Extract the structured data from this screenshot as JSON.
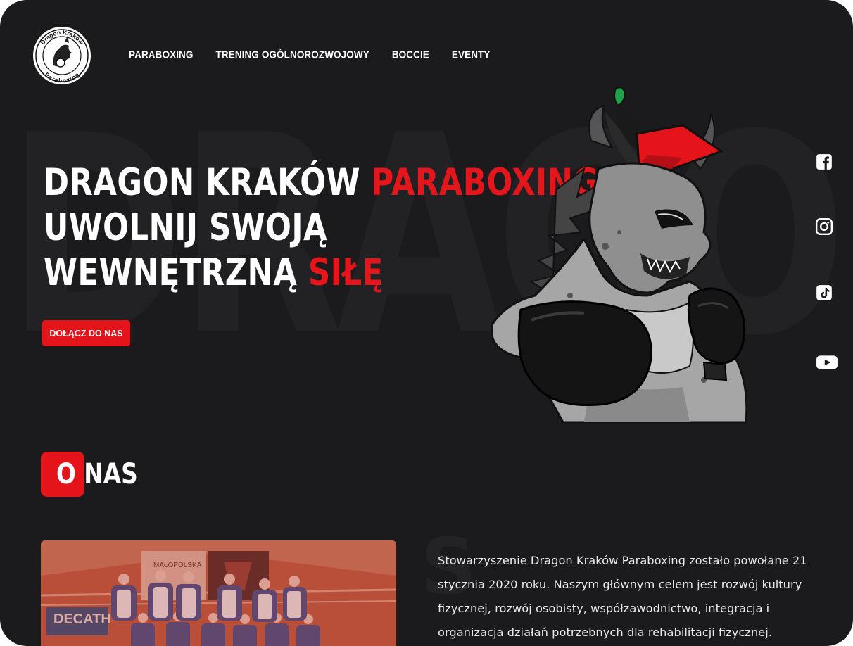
{
  "brand": {
    "logo_alt": "Dragon Kraków Paraboxing logo",
    "logo_top_text": "Dragon Kraków",
    "logo_bottom_text": "Paraboxing",
    "background_word": "DRAGON",
    "colors": {
      "background": "#1b1b1d",
      "accent": "#e4141a",
      "text": "#ffffff"
    }
  },
  "nav": {
    "items": [
      {
        "label": "PARABOXING"
      },
      {
        "label": "TRENING OGÓLNOROZWOJOWY"
      },
      {
        "label": "BOCCIE"
      },
      {
        "label": "EVENTY"
      }
    ]
  },
  "hero": {
    "line1_white": "DRAGON KRAKÓW ",
    "line1_red": "PARABOXING",
    "line2": "UWOLNIJ SWOJĄ",
    "line3_white": "WEWNĘTRZNĄ ",
    "line3_red": "SIŁĘ",
    "cta_label": "DOŁĄCZ DO NAS",
    "mascot": "boxing-dragon-illustration"
  },
  "social": [
    {
      "icon": "facebook-icon"
    },
    {
      "icon": "instagram-icon"
    },
    {
      "icon": "tiktok-icon"
    },
    {
      "icon": "youtube-icon"
    }
  ],
  "about": {
    "title_first": "O",
    "title_rest": " NAS",
    "ghost_letter": "S",
    "photo": "team-group-photo",
    "banner_text": "MAŁOPOLSKA",
    "sign_text": "DECATH",
    "paragraph": "Stowarzyszenie Dragon Kraków Paraboxing zostało powołane 21 stycznia 2020 roku. Naszym głównym celem jest rozwój kultury fizycznej, rozwój osobisty, współzawodnictwo, integracja i organizacja działań potrzebnych dla rehabilitacji fizycznej."
  }
}
